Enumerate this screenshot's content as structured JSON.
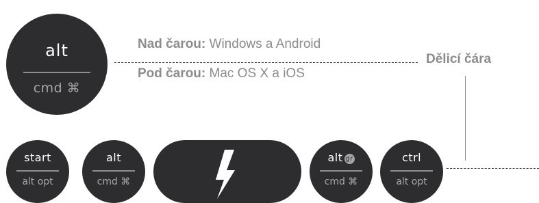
{
  "main_key": {
    "top": "alt",
    "bottom": "cmd ⌘"
  },
  "legend": {
    "above_label": "Nad čarou:",
    "above_text": " Windows a Android",
    "below_label": "Pod čarou:",
    "below_text": " Mac OS X a iOS"
  },
  "divider_label": "Dělicí čára",
  "keys": [
    {
      "top": "start",
      "bottom": "alt opt"
    },
    {
      "top": "alt",
      "bottom": "cmd ⌘"
    },
    {
      "top": "alt",
      "badge": "gr",
      "bottom": "cmd ⌘"
    },
    {
      "top": "ctrl",
      "bottom": "alt opt"
    }
  ],
  "colors": {
    "key": "#2d2d2f",
    "label": "#8c8c8e",
    "bottom_label": "#a7a7a9"
  },
  "icons": {
    "pill": "lightning-bolt-icon"
  }
}
